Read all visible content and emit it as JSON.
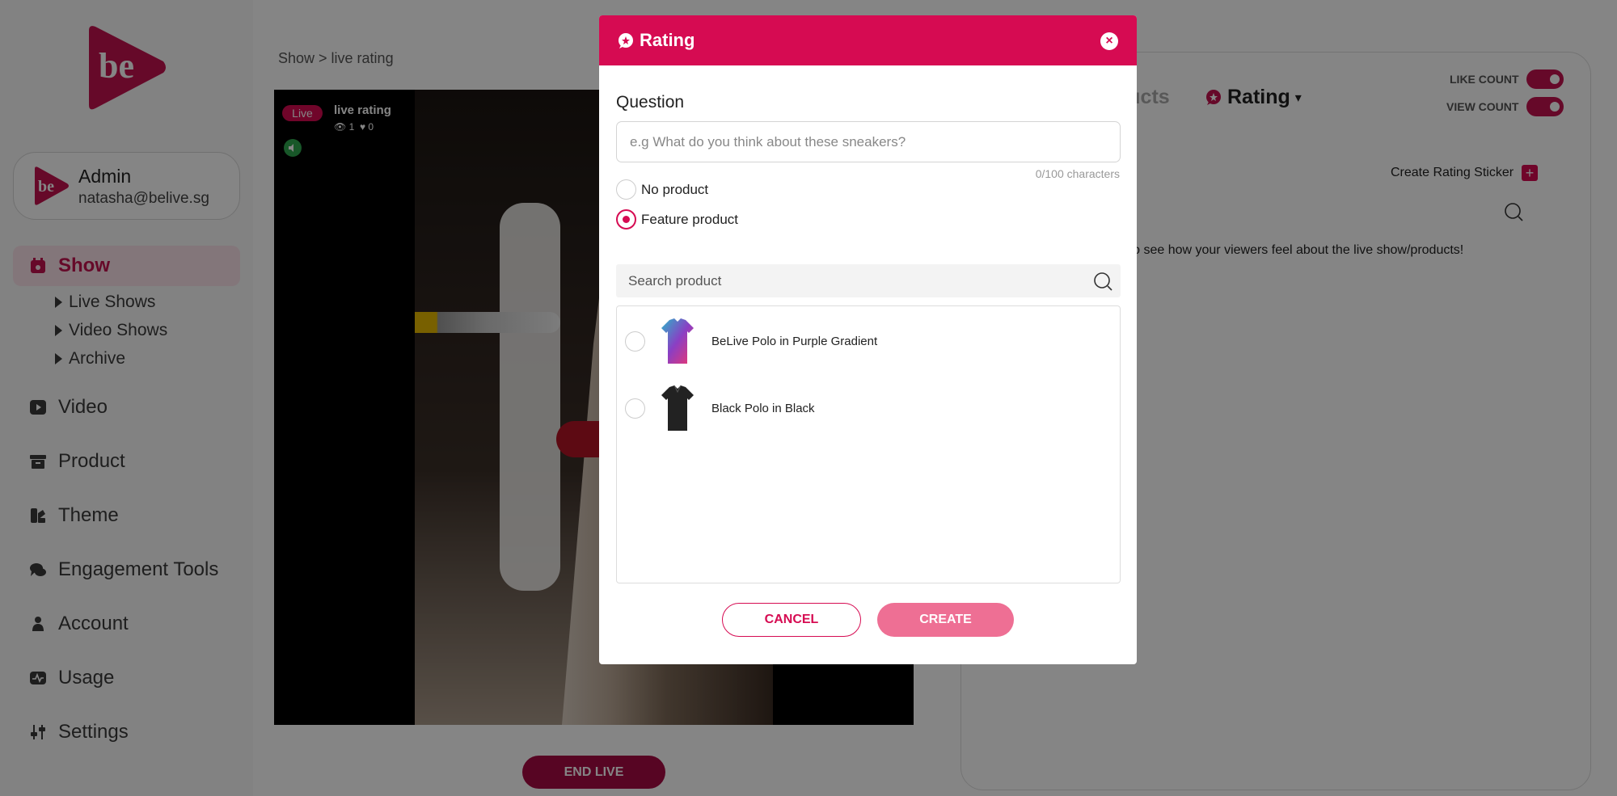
{
  "sidebar": {
    "user": {
      "name": "Admin",
      "email": "natasha@belive.sg"
    },
    "nav": [
      {
        "label": "Show",
        "icon": "calendar-icon",
        "active": true
      },
      {
        "label": "Video",
        "icon": "play-icon"
      },
      {
        "label": "Product",
        "icon": "box-icon"
      },
      {
        "label": "Theme",
        "icon": "palette-icon"
      },
      {
        "label": "Engagement Tools",
        "icon": "chat-icon"
      },
      {
        "label": "Account",
        "icon": "person-icon"
      },
      {
        "label": "Usage",
        "icon": "chart-icon"
      },
      {
        "label": "Settings",
        "icon": "sliders-icon"
      }
    ],
    "sub_items": [
      "Live Shows",
      "Video Shows",
      "Archive"
    ]
  },
  "center": {
    "breadcrumb": "Show  > live rating",
    "live_badge": "Live",
    "live_title": "live rating",
    "views": "1",
    "likes": "0",
    "end_live": "END LIVE"
  },
  "right_panel": {
    "tab_products": "ducts",
    "tab_rating": "Rating",
    "like_count_label": "LIKE COUNT",
    "view_count_label": "VIEW COUNT",
    "like_count_on": true,
    "view_count_on": true,
    "create_sticker": "Create Rating Sticker",
    "hint": "ker to see how your viewers feel about the live show/products!"
  },
  "modal": {
    "title": "Rating",
    "question_label": "Question",
    "question_placeholder": "e.g What do you think about these sneakers?",
    "question_value": "",
    "char_count": "0/100 characters",
    "option_no_product": "No product",
    "option_feature_product": "Feature product",
    "selected_option": "Feature product",
    "search_placeholder": "Search product",
    "products": [
      {
        "name": "BeLive Polo in Purple Gradient",
        "selected": false
      },
      {
        "name": "Black Polo in Black",
        "selected": false
      }
    ],
    "cancel": "CANCEL",
    "create": "CREATE"
  },
  "colors": {
    "accent": "#d60b52",
    "create_button": "#ee6f94",
    "dark_accent": "#a80b44"
  }
}
